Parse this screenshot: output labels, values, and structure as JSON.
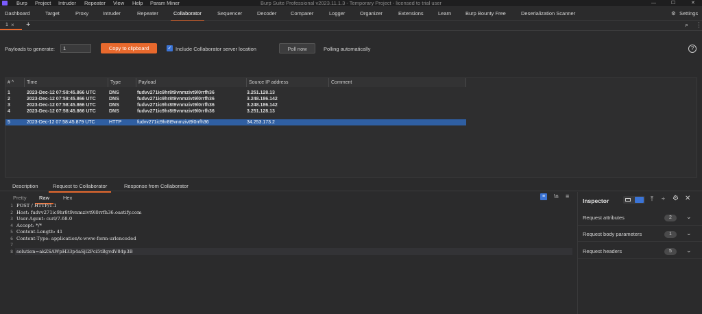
{
  "menubar": {
    "items": [
      "Burp",
      "Project",
      "Intruder",
      "Repeater",
      "View",
      "Help",
      "Param Miner"
    ],
    "title": "Burp Suite Professional v2023.11.1.3 - Temporary Project - licensed to trial user"
  },
  "tabs": [
    "Dashboard",
    "Target",
    "Proxy",
    "Intruder",
    "Repeater",
    "Collaborator",
    "Sequencer",
    "Decoder",
    "Comparer",
    "Logger",
    "Organizer",
    "Extensions",
    "Learn",
    "Burp Bounty Free",
    "Deserialization Scanner"
  ],
  "settings_label": "Settings",
  "subtab": {
    "label": "1",
    "close": "×",
    "add": "+"
  },
  "toolbar": {
    "payloads_label": "Payloads to generate:",
    "payloads_value": "1",
    "copy_label": "Copy to clipboard",
    "include_label": "Include Collaborator server location",
    "poll_label": "Poll now",
    "polling_status": "Polling automatically"
  },
  "table": {
    "headers": [
      "#",
      "Time",
      "Type",
      "Payload",
      "Source IP address",
      "Comment"
    ],
    "rows": [
      {
        "num": "1",
        "time": "2023-Dec-12 07:58:45.866 UTC",
        "type": "DNS",
        "payload": "fudvv271ic9hr8t9vnmzivt9l0rrfh36",
        "ip": "3.251.128.13",
        "comment": ""
      },
      {
        "num": "2",
        "time": "2023-Dec-12 07:58:45.866 UTC",
        "type": "DNS",
        "payload": "fudvv271ic9hr8t9vnmzivt9l0rrfh36",
        "ip": "3.248.186.142",
        "comment": ""
      },
      {
        "num": "3",
        "time": "2023-Dec-12 07:58:45.866 UTC",
        "type": "DNS",
        "payload": "fudvv271ic9hr8t9vnmzivt9l0rrfh36",
        "ip": "3.248.186.142",
        "comment": ""
      },
      {
        "num": "4",
        "time": "2023-Dec-12 07:58:45.866 UTC",
        "type": "DNS",
        "payload": "fudvv271ic9hr8t9vnmzivt9l0rrfh36",
        "ip": "3.251.128.13",
        "comment": ""
      },
      {
        "num": "5",
        "time": "2023-Dec-12 07:58:45.879 UTC",
        "type": "HTTP",
        "payload": "fudvv271ic9hr8t9vnmzivt9l0rrfh36",
        "ip": "34.253.173.2",
        "comment": ""
      }
    ]
  },
  "detail_tabs": [
    "Description",
    "Request to Collaborator",
    "Response from Collaborator"
  ],
  "view_tabs": [
    "Pretty",
    "Raw",
    "Hex"
  ],
  "editor_lines": [
    {
      "n": "1",
      "text": "POST / HTTP/1.1"
    },
    {
      "n": "2",
      "text": "Host: fudvv271ic9hr8t9vnmzivt9l0rrfh36.oastify.com"
    },
    {
      "n": "3",
      "text": "User-Agent: curl/7.68.0"
    },
    {
      "n": "4",
      "text": "Accept: */*"
    },
    {
      "n": "5",
      "text": "Content-Length: 41"
    },
    {
      "n": "6",
      "text": "Content-Type: application/x-www-form-urlencoded"
    },
    {
      "n": "7",
      "text": ""
    },
    {
      "n": "8",
      "text": "solution=akZSAWpH33p4aSjl2Pci5tBgvdV84p3B"
    }
  ],
  "inspector": {
    "title": "Inspector",
    "sections": [
      {
        "label": "Request attributes",
        "count": "2"
      },
      {
        "label": "Request body parameters",
        "count": "1"
      },
      {
        "label": "Request headers",
        "count": "5"
      }
    ]
  },
  "colors": {
    "accent": "#e8692d",
    "selection": "#2f5fa3",
    "background": "#2b2b2c"
  }
}
